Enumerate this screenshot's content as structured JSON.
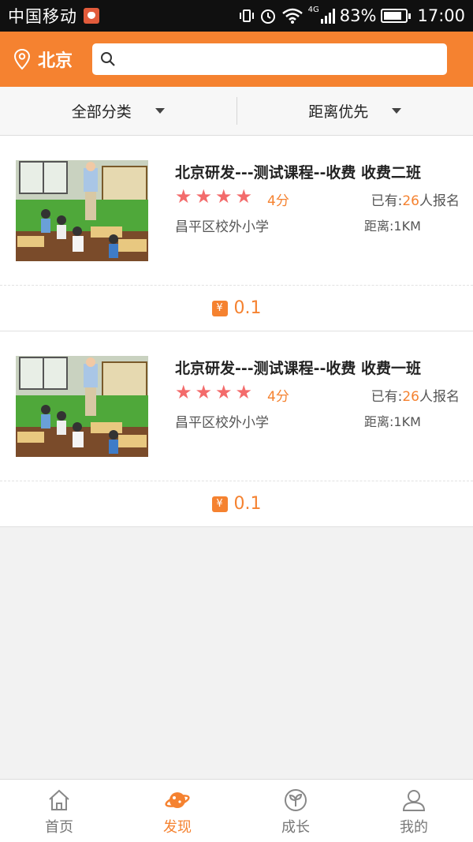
{
  "statusbar": {
    "carrier": "中国移动",
    "network": "4G",
    "battery": "83%",
    "battery_level": 0.83,
    "time": "17:00"
  },
  "header": {
    "city": "北京",
    "search_placeholder": ""
  },
  "filters": [
    {
      "label": "全部分类"
    },
    {
      "label": "距离优先"
    }
  ],
  "courses": [
    {
      "title": "北京研发---测试课程--收费 收费二班",
      "stars": 4,
      "score": "4分",
      "enroll_prefix": "已有:",
      "enroll_count": "26",
      "enroll_suffix": "人报名",
      "school": "昌平区校外小学",
      "distance": "距离:1KM",
      "price_icon": "¥",
      "price": "0.1"
    },
    {
      "title": "北京研发---测试课程--收费 收费一班",
      "stars": 4,
      "score": "4分",
      "enroll_prefix": "已有:",
      "enroll_count": "26",
      "enroll_suffix": "人报名",
      "school": "昌平区校外小学",
      "distance": "距离:1KM",
      "price_icon": "¥",
      "price": "0.1"
    }
  ],
  "nav": [
    {
      "label": "首页",
      "icon": "home-icon"
    },
    {
      "label": "发现",
      "icon": "discover-icon"
    },
    {
      "label": "成长",
      "icon": "growth-icon"
    },
    {
      "label": "我的",
      "icon": "profile-icon"
    }
  ],
  "colors": {
    "accent": "#f58230",
    "star": "#f36b6b"
  }
}
